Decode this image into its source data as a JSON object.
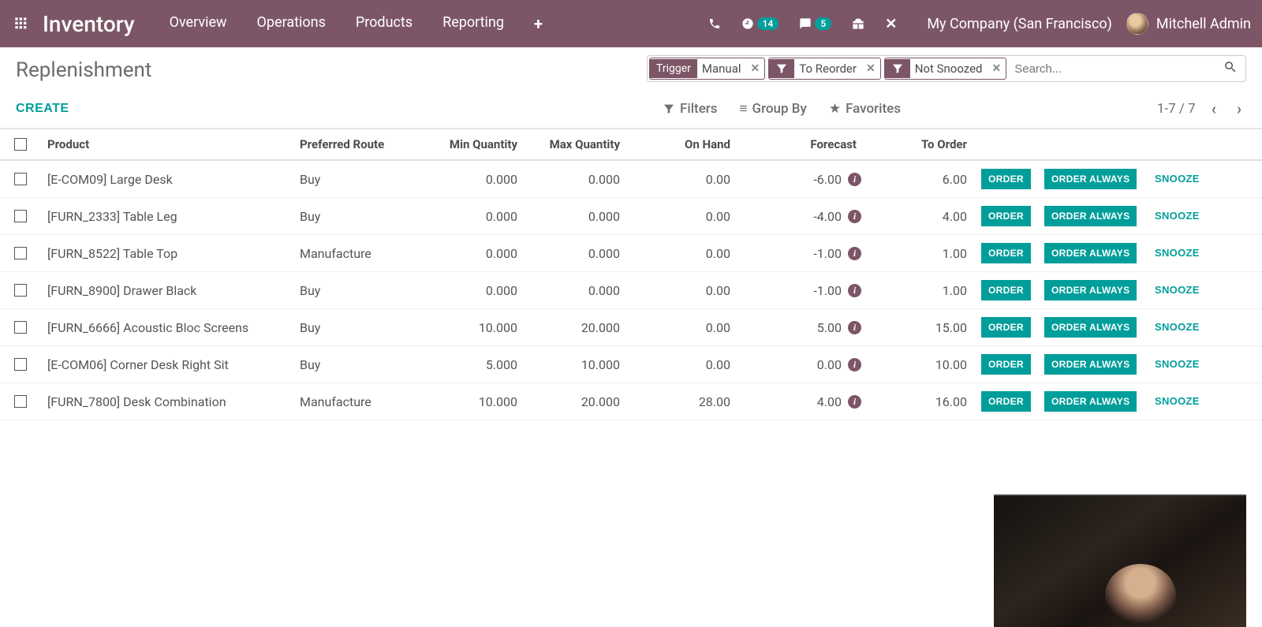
{
  "colors": {
    "primary": "#7c5666",
    "accent": "#009e9a"
  },
  "nav": {
    "brand": "Inventory",
    "items": [
      "Overview",
      "Operations",
      "Products",
      "Reporting"
    ],
    "badges": {
      "activities": "14",
      "messages": "5"
    },
    "company": "My Company (San Francisco)",
    "user": "Mitchell Admin"
  },
  "page": {
    "title": "Replenishment",
    "create": "CREATE",
    "facets": [
      {
        "label": "Trigger",
        "value": "Manual",
        "type": "field"
      },
      {
        "label": "filter",
        "value": "To Reorder",
        "type": "filter"
      },
      {
        "label": "filter",
        "value": "Not Snoozed",
        "type": "filter"
      }
    ],
    "search_placeholder": "Search...",
    "toolbar": {
      "filters": "Filters",
      "groupby": "Group By",
      "favorites": "Favorites"
    },
    "pager": "1-7 / 7"
  },
  "columns": [
    "Product",
    "Preferred Route",
    "Min Quantity",
    "Max Quantity",
    "On Hand",
    "Forecast",
    "To Order"
  ],
  "buttons": {
    "order": "ORDER",
    "order_always": "ORDER ALWAYS",
    "snooze": "SNOOZE"
  },
  "rows": [
    {
      "product": "[E-COM09] Large Desk",
      "route": "Buy",
      "min": "0.000",
      "max": "0.000",
      "onhand": "0.00",
      "forecast": "-6.00",
      "toorder": "6.00"
    },
    {
      "product": "[FURN_2333] Table Leg",
      "route": "Buy",
      "min": "0.000",
      "max": "0.000",
      "onhand": "0.00",
      "forecast": "-4.00",
      "toorder": "4.00"
    },
    {
      "product": "[FURN_8522] Table Top",
      "route": "Manufacture",
      "min": "0.000",
      "max": "0.000",
      "onhand": "0.00",
      "forecast": "-1.00",
      "toorder": "1.00"
    },
    {
      "product": "[FURN_8900] Drawer Black",
      "route": "Buy",
      "min": "0.000",
      "max": "0.000",
      "onhand": "0.00",
      "forecast": "-1.00",
      "toorder": "1.00"
    },
    {
      "product": "[FURN_6666] Acoustic Bloc Screens",
      "route": "Buy",
      "min": "10.000",
      "max": "20.000",
      "onhand": "0.00",
      "forecast": "5.00",
      "toorder": "15.00"
    },
    {
      "product": "[E-COM06] Corner Desk Right Sit",
      "route": "Buy",
      "min": "5.000",
      "max": "10.000",
      "onhand": "0.00",
      "forecast": "0.00",
      "toorder": "10.00"
    },
    {
      "product": "[FURN_7800] Desk Combination",
      "route": "Manufacture",
      "min": "10.000",
      "max": "20.000",
      "onhand": "28.00",
      "forecast": "4.00",
      "toorder": "16.00"
    }
  ]
}
